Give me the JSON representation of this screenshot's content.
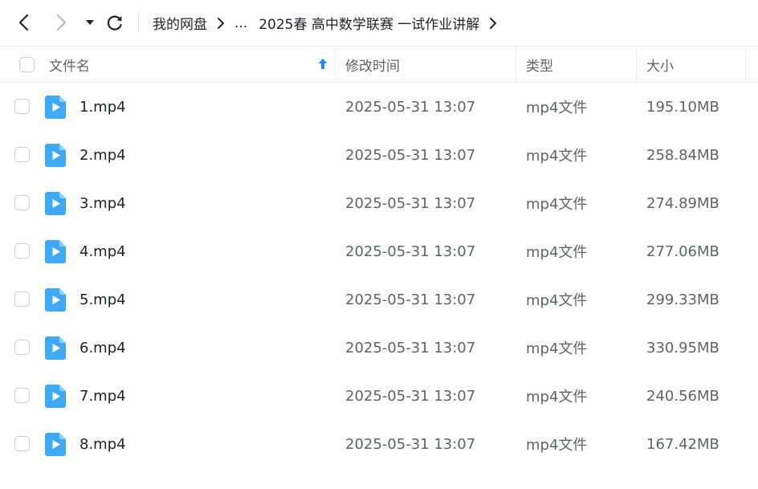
{
  "nav": {
    "back_icon": "chevron-left-icon",
    "forward_icon": "chevron-right-icon",
    "history_icon": "caret-down-icon",
    "refresh_icon": "refresh-icon"
  },
  "breadcrumb": {
    "root": "我的网盘",
    "ellipsis": "...",
    "current": "2025春 高中数学联赛 一试作业讲解"
  },
  "table": {
    "headers": {
      "name": "文件名",
      "modified": "修改时间",
      "type": "类型",
      "size": "大小"
    },
    "sort_icon": "sort-ascending-arrow-icon",
    "file_icon": "video-file-icon",
    "rows": [
      {
        "name": "1.mp4",
        "modified": "2025-05-31 13:07",
        "type": "mp4文件",
        "size": "195.10MB"
      },
      {
        "name": "2.mp4",
        "modified": "2025-05-31 13:07",
        "type": "mp4文件",
        "size": "258.84MB"
      },
      {
        "name": "3.mp4",
        "modified": "2025-05-31 13:07",
        "type": "mp4文件",
        "size": "274.89MB"
      },
      {
        "name": "4.mp4",
        "modified": "2025-05-31 13:07",
        "type": "mp4文件",
        "size": "277.06MB"
      },
      {
        "name": "5.mp4",
        "modified": "2025-05-31 13:07",
        "type": "mp4文件",
        "size": "299.33MB"
      },
      {
        "name": "6.mp4",
        "modified": "2025-05-31 13:07",
        "type": "mp4文件",
        "size": "330.95MB"
      },
      {
        "name": "7.mp4",
        "modified": "2025-05-31 13:07",
        "type": "mp4文件",
        "size": "240.56MB"
      },
      {
        "name": "8.mp4",
        "modified": "2025-05-31 13:07",
        "type": "mp4文件",
        "size": "167.42MB"
      }
    ]
  },
  "colors": {
    "accent": "#1a8cff",
    "file_icon": "#3fa9f5",
    "text_primary": "#1f2329",
    "text_secondary": "#5f6368",
    "divider": "#eef0f2"
  }
}
